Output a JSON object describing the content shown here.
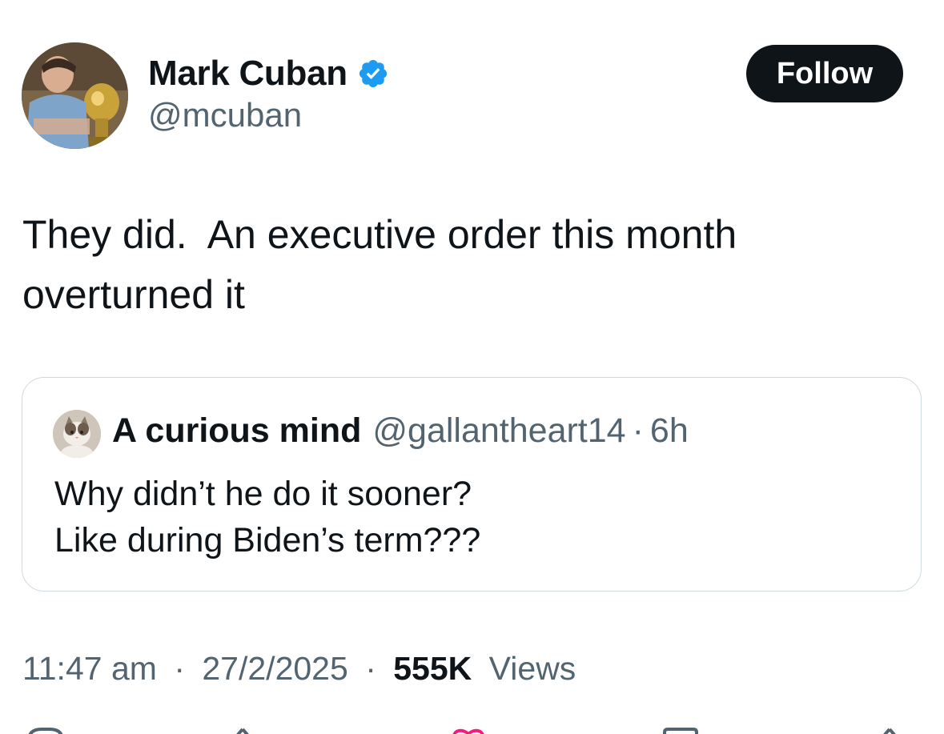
{
  "author": {
    "name": "Mark Cuban",
    "handle": "@mcuban",
    "avatar_icon": "profile-photo",
    "verified_color": "#1d9bf0"
  },
  "follow_button": {
    "label": "Follow"
  },
  "tweet": {
    "text": "They did.  An executive order this month\noverturned it"
  },
  "quoted_tweet": {
    "name": "A curious mind",
    "handle": "@gallantheart14",
    "separator": "·",
    "age": "6h",
    "text": "Why didn’t he do it sooner?\nLike during Biden’s term???",
    "avatar_icon": "cat-photo"
  },
  "meta": {
    "time": "11:47 am",
    "date": "27/2/2025",
    "separator": "·",
    "views_count": "555K",
    "views_label": "Views"
  },
  "actions": [
    {
      "icon": "reply-icon"
    },
    {
      "icon": "repost-icon"
    },
    {
      "icon": "like-icon"
    },
    {
      "icon": "bookmark-icon"
    },
    {
      "icon": "share-icon"
    }
  ],
  "colors": {
    "primary_text": "#0f1419",
    "secondary_text": "#536471",
    "border": "#cfd9de",
    "like_accent": "#f91880"
  }
}
